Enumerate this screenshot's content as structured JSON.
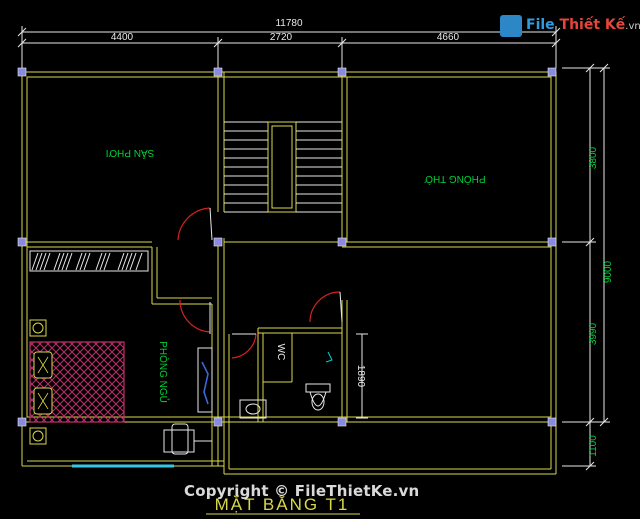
{
  "dimensions": {
    "total_width": "11780",
    "segments": [
      "4400",
      "2720",
      "4660"
    ],
    "right_side": [
      "3800",
      "9000",
      "3990",
      "1100"
    ],
    "wc_depth": "1890"
  },
  "rooms": {
    "living": "SẢN PHƠI",
    "worship": "PHÒNG THỜ",
    "bedroom": "PHÒNG NGỦ",
    "wc": "WC"
  },
  "title": "MẶT BẰNG T1",
  "watermark": {
    "logo_word1": "File",
    "logo_word2": "Thiết Kế",
    "logo_suffix": ".vn",
    "copyright": "Copyright © FileThietKe.vn"
  },
  "colors": {
    "background": "#000000",
    "wall": "#d8d84a",
    "dimension": "#e8e8e8",
    "room_text": "#00d23a",
    "door": "#d81e1e",
    "bed": "#c0306c",
    "column": "#8a8ae0",
    "window": "#35c7e8",
    "outline": "#e8e8e8"
  }
}
